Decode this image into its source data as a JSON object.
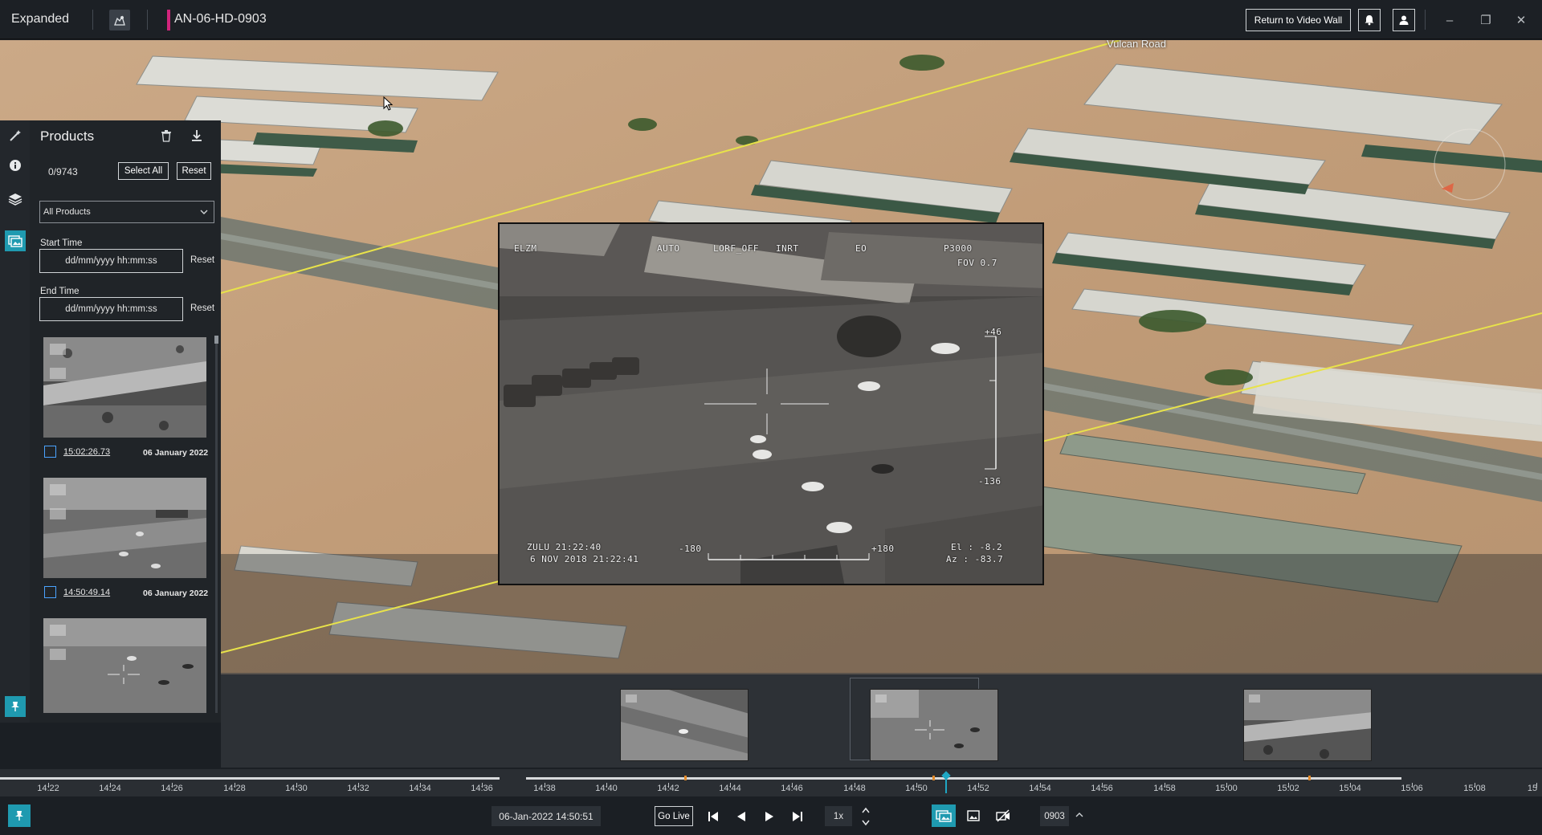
{
  "topbar": {
    "mode_label": "Expanded",
    "feed_id": "AN-06-HD-0903",
    "feed_accent_color": "#d1247b",
    "return_label": "Return to Video Wall",
    "icons": [
      "map-person-icon",
      "bell-icon",
      "user-icon",
      "minimize-icon",
      "restore-icon",
      "close-icon"
    ]
  },
  "map": {
    "road_label": "Vulcan Road"
  },
  "video": {
    "osd": {
      "sensor": "ELZM",
      "mode": "AUTO",
      "lorf": "LORF_OFF",
      "inrt": "INRT",
      "eo": "EO",
      "zoom": "P3000",
      "fov": "FOV  0.7",
      "el_top": "+46",
      "el_bottom": "-136",
      "az_left": "-180",
      "az_right": "+180",
      "zulu": "ZULU 21:22:40",
      "date_line": "6 NOV 2018 21:22:41",
      "el_readout": "El :  -8.2",
      "az_readout": "Az : -83.7"
    }
  },
  "products": {
    "title": "Products",
    "count": "0/9743",
    "select_all": "Select All",
    "reset": "Reset",
    "filter_value": "All Products",
    "start_label": "Start Time",
    "end_label": "End Time",
    "time_placeholder": "dd/mm/yyyy hh:mm:ss",
    "field_reset": "Reset",
    "items": [
      {
        "time": "15:02:26.73",
        "date": "06 January 2022"
      },
      {
        "time": "14:50:49.14",
        "date": "06 January 2022"
      },
      {
        "time": "",
        "date": ""
      }
    ]
  },
  "timeline": {
    "ticks": [
      "14:22",
      "14:24",
      "14:26",
      "14:28",
      "14:30",
      "14:32",
      "14:34",
      "14:36",
      "14:38",
      "14:40",
      "14:42",
      "14:44",
      "14:46",
      "14:48",
      "14:50",
      "14:52",
      "14:54",
      "14:56",
      "14:58",
      "15:00",
      "15:02",
      "15:04",
      "15:06",
      "15:08",
      "15"
    ],
    "marker_color": "#e08a2c",
    "playhead_color": "#1fa7c4"
  },
  "bottombar": {
    "datetime": "06-Jan-2022 14:50:51",
    "go_live": "Go Live",
    "speed": "1x",
    "feed_short": "0903",
    "accent": "#1f9ab0"
  }
}
